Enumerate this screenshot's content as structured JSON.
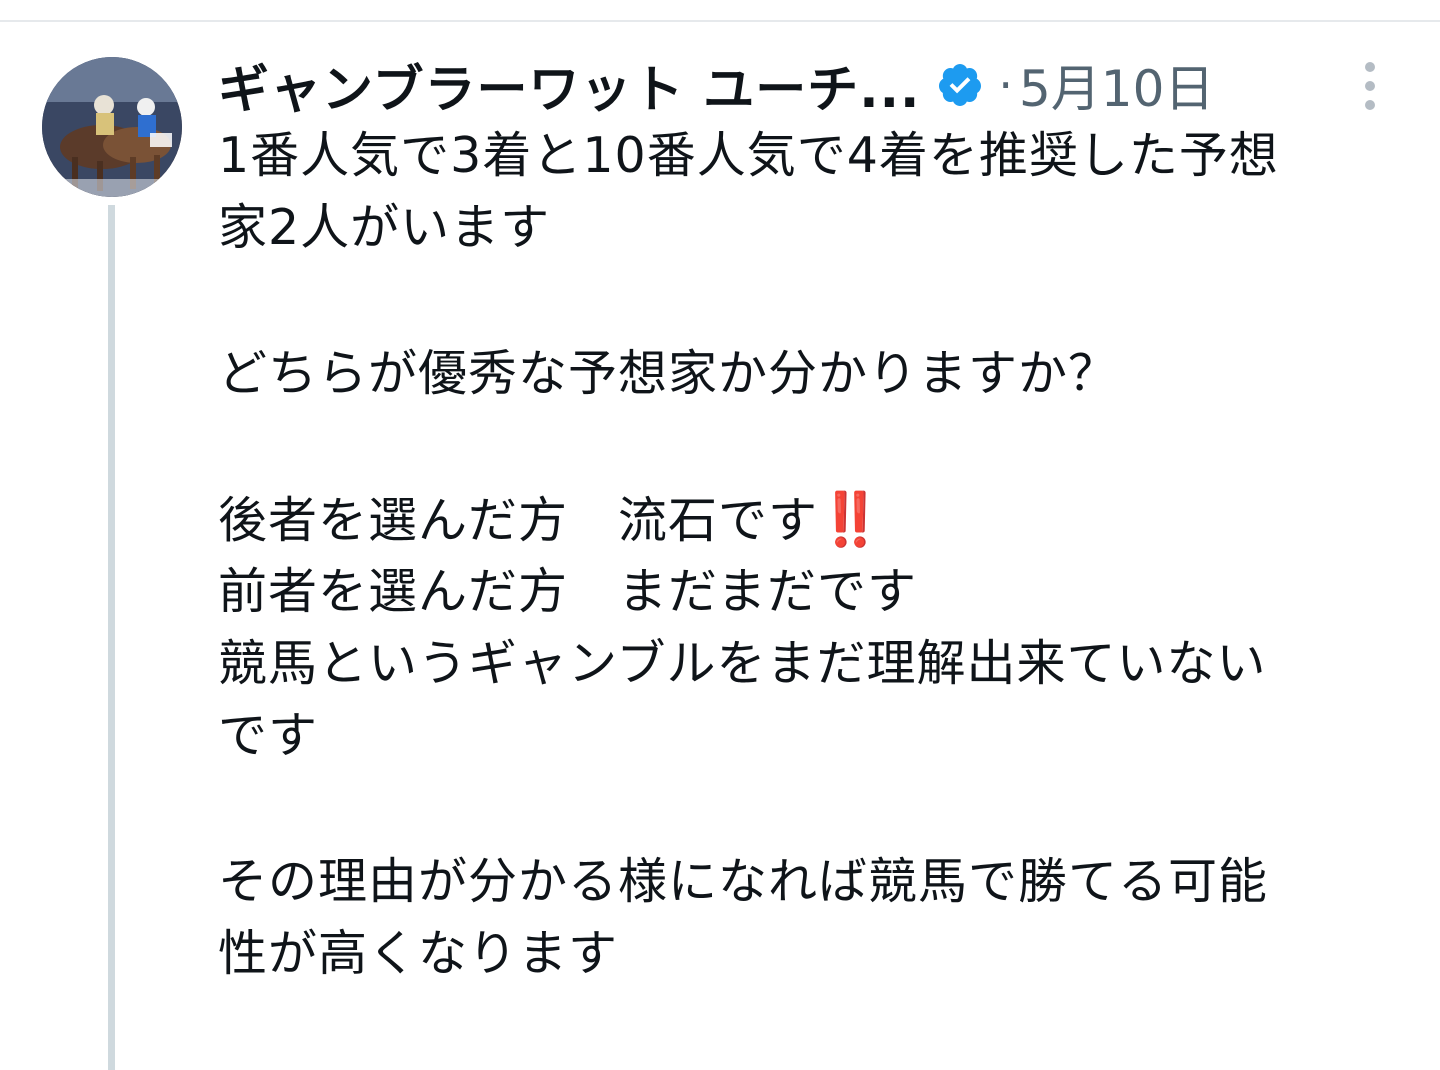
{
  "tweet": {
    "author": {
      "display_name": "ギャンブラーワット ユーチ...",
      "verified": true,
      "avatar_description_icon": "horse-racing-avatar"
    },
    "separator": "·",
    "timestamp": "5月10日",
    "lines": [
      "1番人気で3着と10番人気で4着を推奨した予想",
      "家2人がいます",
      "",
      "どちらが優秀な予想家か分かりますか？",
      "",
      "後者を選んだ方　流石です",
      "前者を選んだ方　まだまだです",
      "競馬というギャンブルをまだ理解出来ていない",
      "です",
      "",
      "その理由が分かる様になれば競馬で勝てる可能",
      "性が高くなります"
    ],
    "emoji_after_line_6": "‼️"
  },
  "colors": {
    "text": "#0f1419",
    "secondary": "#536471",
    "verified": "#1d9bf0",
    "thread_line": "#cfd9de"
  }
}
